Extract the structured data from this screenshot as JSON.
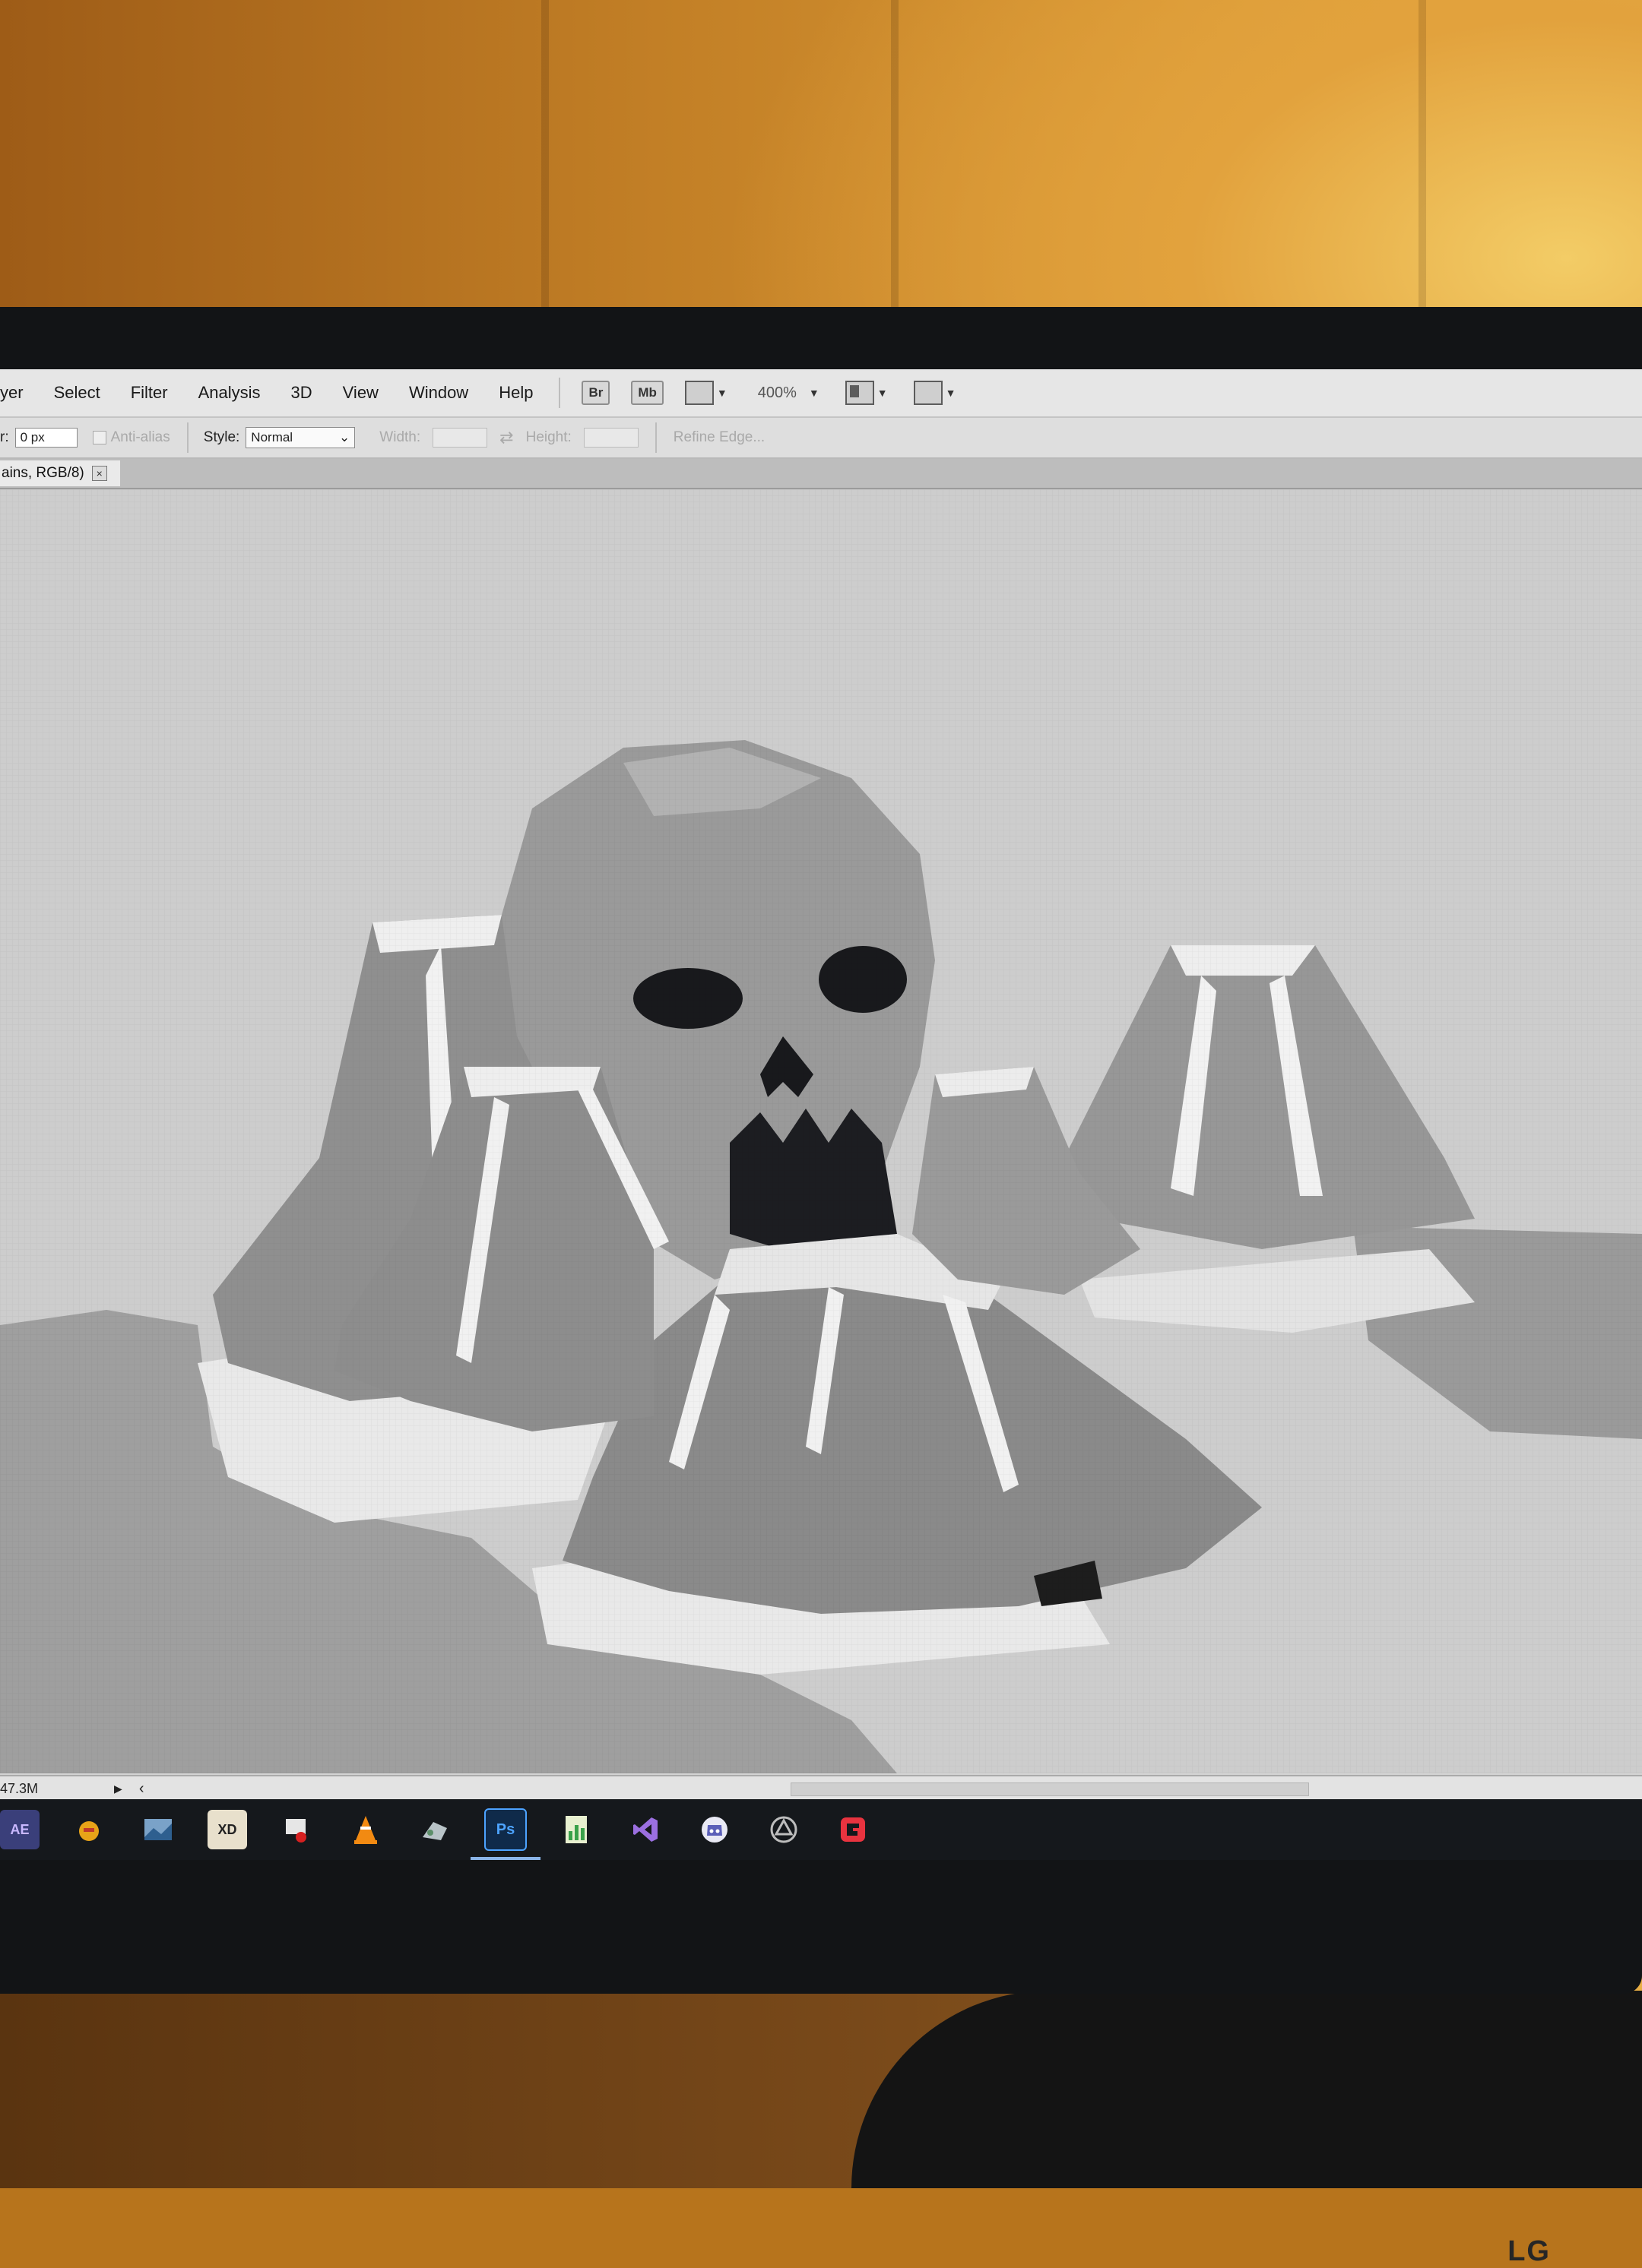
{
  "menubar": {
    "items": [
      "yer",
      "Select",
      "Filter",
      "Analysis",
      "3D",
      "View",
      "Window",
      "Help"
    ],
    "bridge_label": "Br",
    "minibridge_label": "Mb",
    "zoom": "400%"
  },
  "options": {
    "feather_label": "r:",
    "feather_value": "0 px",
    "anti_alias_label": "Anti-alias",
    "style_label": "Style:",
    "style_value": "Normal",
    "width_label": "Width:",
    "height_label": "Height:",
    "refine_edge_label": "Refine Edge..."
  },
  "document": {
    "tab_title": "ains, RGB/8)",
    "close_label": "×"
  },
  "status": {
    "doc_size": "47.3M"
  },
  "taskbar": {
    "apps": [
      {
        "label": "AE",
        "icon": "after-effects-icon"
      },
      {
        "label": "",
        "icon": "game-app-icon"
      },
      {
        "label": "",
        "icon": "tiled-map-editor-icon"
      },
      {
        "label": "XD",
        "icon": "xd-app-icon"
      },
      {
        "label": "",
        "icon": "screen-recorder-icon"
      },
      {
        "label": "",
        "icon": "vlc-cone-icon"
      },
      {
        "label": "",
        "icon": "paint-app-icon"
      },
      {
        "label": "Ps",
        "icon": "photoshop-icon"
      },
      {
        "label": "",
        "icon": "chart-app-icon"
      },
      {
        "label": "",
        "icon": "visual-studio-icon"
      },
      {
        "label": "",
        "icon": "discord-like-icon"
      },
      {
        "label": "",
        "icon": "unity-icon"
      },
      {
        "label": "",
        "icon": "game-maker-icon"
      }
    ]
  },
  "monitor": {
    "brand": "LG"
  },
  "colors": {
    "menubar_bg": "#e6e6e6",
    "canvas_bg": "#cfcfcf",
    "taskbar_bg": "#15181c",
    "photoshop_blue": "#2a64b8",
    "wall_orange": "#d69532"
  }
}
